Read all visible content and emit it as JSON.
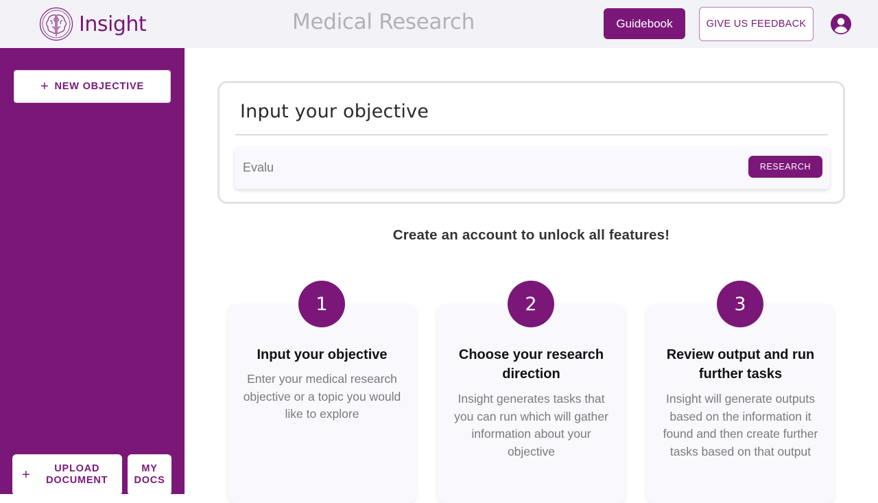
{
  "header": {
    "logo_text": "Insight",
    "app_title": "Medical Research",
    "guidebook_label": "Guidebook",
    "feedback_label": "GIVE US FEEDBACK",
    "avatar_icon": "user-circle-icon"
  },
  "sidebar": {
    "new_objective_label": "NEW OBJECTIVE",
    "upload_label_line1": "UPLOAD",
    "upload_label_line2": "DOCUMENT",
    "mydocs_label_line1": "MY",
    "mydocs_label_line2": "DOCS",
    "plus_icon": "plus-icon"
  },
  "objective": {
    "heading": "Input your objective",
    "input_value": "Evalu",
    "research_label": "RESEARCH"
  },
  "cta": "Create an account to unlock all features!",
  "steps": [
    {
      "number": "1",
      "title": "Input your objective",
      "desc": "Enter your medical research objective or a topic you would like to explore"
    },
    {
      "number": "2",
      "title": "Choose your research direction",
      "desc": "Insight generates tasks that you can run which will gather information about your objective"
    },
    {
      "number": "3",
      "title": "Review output and run further tasks",
      "desc": "Insight will generate outputs based on the information it found and then create further tasks based on that output"
    }
  ],
  "colors": {
    "brand": "#7b1778",
    "header_bg": "#f3f3f7",
    "card_bg": "#f9f8fc"
  }
}
